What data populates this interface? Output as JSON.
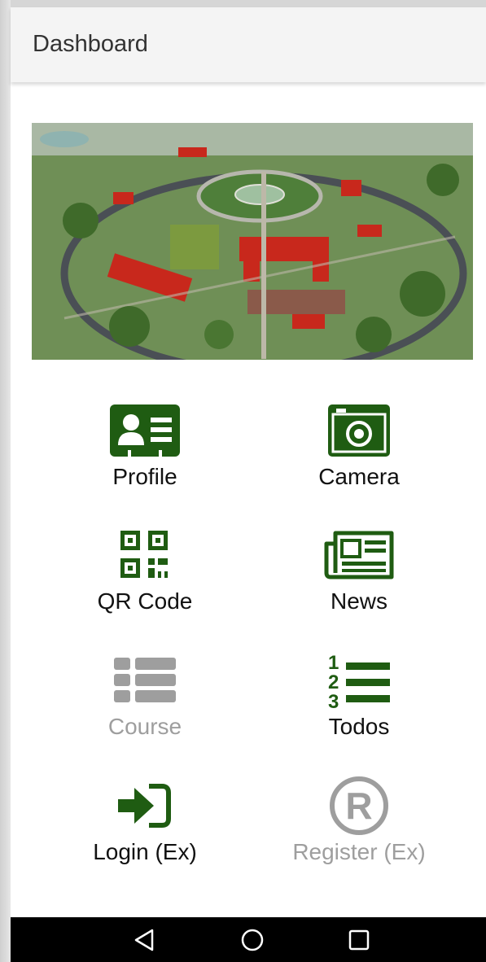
{
  "appbar": {
    "title": "Dashboard"
  },
  "banner": {
    "alt": "Aerial view of campus"
  },
  "colors": {
    "icon_green": "#1f5c12",
    "disabled_gray": "#9e9e9e",
    "text": "#111111"
  },
  "menu": [
    {
      "label": "Profile",
      "icon": "id-card-icon",
      "enabled": true
    },
    {
      "label": "Camera",
      "icon": "camera-icon",
      "enabled": true
    },
    {
      "label": "QR Code",
      "icon": "qr-code-icon",
      "enabled": true
    },
    {
      "label": "News",
      "icon": "newspaper-icon",
      "enabled": true
    },
    {
      "label": "Course",
      "icon": "list-icon",
      "enabled": false
    },
    {
      "label": "Todos",
      "icon": "numbered-list-icon",
      "enabled": true
    },
    {
      "label": "Login (Ex)",
      "icon": "sign-in-icon",
      "enabled": true
    },
    {
      "label": "Register (Ex)",
      "icon": "registered-icon",
      "enabled": false
    }
  ],
  "navbar": {
    "buttons": [
      "back-icon",
      "home-icon",
      "recents-icon"
    ]
  }
}
